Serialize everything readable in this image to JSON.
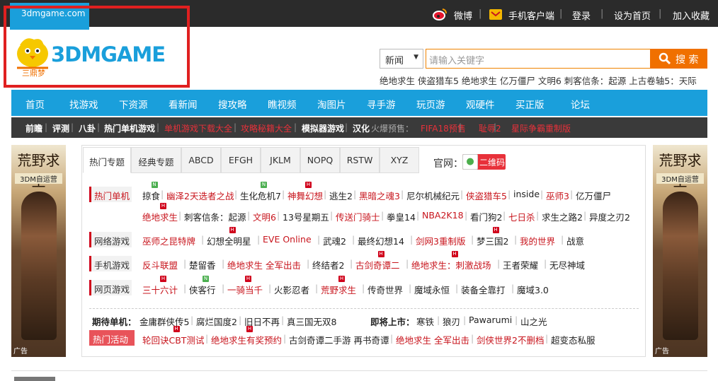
{
  "topbar": {
    "site_tab": "3dmgame.com",
    "weibo": "微博",
    "mobile_client": "手机客户端",
    "login": "登录",
    "set_home": "设为首页",
    "bookmark": "加入收藏"
  },
  "logo": {
    "text": "3DMGAME",
    "sub": "三鼎梦"
  },
  "search": {
    "category": "新闻",
    "placeholder": "请输入关键字",
    "button": "搜 索",
    "hot_keywords": "绝地求生 侠盗猎车5 绝地求生 亿万僵尸 文明6 刺客信条：起源 上古卷轴5：天际"
  },
  "nav": [
    "首页",
    "找游戏",
    "下资源",
    "看新闻",
    "搜攻略",
    "瞧视频",
    "淘图片",
    "寻手游",
    "玩页游",
    "观硬件",
    "买正版",
    "论坛"
  ],
  "subnav": [
    {
      "t": "前瞻",
      "c": "w"
    },
    {
      "t": "|",
      "c": "s"
    },
    {
      "t": "评测",
      "c": "w"
    },
    {
      "t": "|",
      "c": "s"
    },
    {
      "t": "八卦",
      "c": "w"
    },
    {
      "t": "|",
      "c": "s"
    },
    {
      "t": "热门单机游戏",
      "c": "w"
    },
    {
      "t": "|",
      "c": "s"
    },
    {
      "t": "单机游戏下载大全",
      "c": "r"
    },
    {
      "t": "|",
      "c": "s"
    },
    {
      "t": "攻略秘籍大全",
      "c": "r"
    },
    {
      "t": "|",
      "c": "s"
    },
    {
      "t": "模拟器游戏",
      "c": "w"
    },
    {
      "t": "|",
      "c": "s"
    },
    {
      "t": "汉化",
      "c": "w"
    },
    {
      "t": "火爆预售：",
      "c": "g"
    },
    {
      "t": "FIFA18预售",
      "c": "r"
    },
    {
      "t": "|",
      "c": "s"
    },
    {
      "t": "耻辱2",
      "c": "r"
    },
    {
      "t": "|",
      "c": "s"
    },
    {
      "t": "星际争霸重制版",
      "c": "r"
    }
  ],
  "banner": {
    "title": "荒野求生",
    "subtitle": "3DM自运营",
    "ad": "广告"
  },
  "tabs": [
    "热门专题",
    "经典专题",
    "ABCD",
    "EFGH",
    "JKLM",
    "NOPQ",
    "RSTW",
    "XYZ"
  ],
  "official": {
    "label": "官网：",
    "qr": "二维码"
  },
  "sections": {
    "hot_single": {
      "label": "热门单机",
      "row1": [
        "掠食",
        "幽泽2天选者之战",
        "生化危机7",
        "神舞幻想",
        "逃生2",
        "黑暗之魂3",
        "尼尔机械纪元",
        "侠盗猎车5",
        "inside",
        "巫师3",
        "亿万僵尸"
      ],
      "row2": [
        "绝地求生",
        "刺客信条：起源",
        "文明6",
        "13号星期五",
        "传送门骑士",
        "拳皇14",
        "NBA2K18",
        "看门狗2",
        "七日杀",
        "求生之路2",
        "异度之刃2"
      ]
    },
    "online": {
      "label": "网络游戏",
      "items": [
        "巫师之昆特牌",
        "幻想全明星",
        "EVE Online",
        "武魂2",
        "最终幻想14",
        "剑网3重制版",
        "梦三国2",
        "我的世界",
        "战意"
      ]
    },
    "mobile": {
      "label": "手机游戏",
      "items": [
        "反斗联盟",
        "楚留香",
        "绝地求生 全军出击",
        "终结者2",
        "古剑奇谭二",
        "绝地求生：刺激战场",
        "王者荣耀",
        "无尽神域"
      ]
    },
    "web": {
      "label": "网页游戏",
      "items": [
        "三十六计",
        "侠客行",
        "一骑当千",
        "火影忍者",
        "荒野求生",
        "传奇世界",
        "魔域永恒",
        "装备全靠打",
        "魔域3.0"
      ]
    }
  },
  "expect": {
    "label": "期待单机：",
    "items": [
      "金庸群侠传5",
      "腐烂国度2",
      "旧日不再",
      "真三国无双8"
    ]
  },
  "upcoming": {
    "label": "即将上市：",
    "items": [
      "寒铁",
      "狼刃",
      "Pawarumi",
      "山之光"
    ]
  },
  "activity": {
    "label": "热门活动",
    "items": [
      "轮回诀CBT测试",
      "绝地求生有奖预约",
      "古剑奇谭二手游 再书奇谭",
      "绝地求生 全军出击",
      "剑侠世界2不删档",
      "超变态私服"
    ]
  },
  "colors": {
    "brand_blue": "#1a9fdb",
    "accent_red": "#c8151d",
    "search_orange": "#f07000"
  }
}
